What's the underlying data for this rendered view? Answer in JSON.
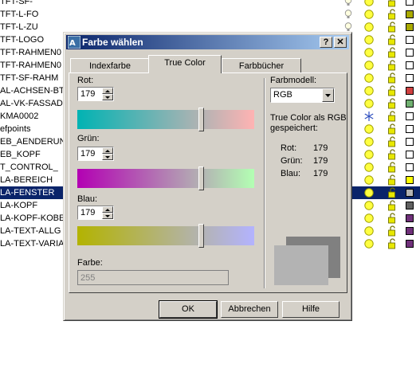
{
  "layers": [
    {
      "name": "TFT-SF-",
      "swatch": "#ffffff",
      "state": "off-sun"
    },
    {
      "name": "TFT-L-FO",
      "swatch": "#aaaa00",
      "state": "off"
    },
    {
      "name": "TFT-L-ZU",
      "swatch": "#aaaa00",
      "state": "off"
    },
    {
      "name": "TFT-LOGO",
      "swatch": "#ffffff",
      "state": "on"
    },
    {
      "name": "TFT-RAHMEN0",
      "swatch": "#ffffff",
      "state": "on"
    },
    {
      "name": "TFT-RAHMEN0",
      "swatch": "#ffffff",
      "state": "on"
    },
    {
      "name": "TFT-SF-RAHM",
      "swatch": "#ffffff",
      "state": "on"
    },
    {
      "name": "AL-ACHSEN-BT",
      "swatch": "#d04040",
      "state": "on"
    },
    {
      "name": "AL-VK-FASSAD",
      "swatch": "#70b070",
      "state": "on"
    },
    {
      "name": "KMA0002",
      "swatch": "#ffffff",
      "state": "frozen"
    },
    {
      "name": "efpoints",
      "swatch": "#ffffff",
      "state": "on"
    },
    {
      "name": "EB_AENDERUN",
      "swatch": "#ffffff",
      "state": "on"
    },
    {
      "name": "EB_KOPF",
      "swatch": "#ffffff",
      "state": "on"
    },
    {
      "name": "T_CONTROL_",
      "swatch": "#ffffff",
      "state": "on"
    },
    {
      "name": "LA-BEREICH",
      "swatch": "#ffff00",
      "state": "on"
    },
    {
      "name": "LA-FENSTER",
      "swatch": "#b3b3b3",
      "state": "selected"
    },
    {
      "name": "LA-KOPF",
      "swatch": "#606060",
      "state": "on"
    },
    {
      "name": "LA-KOPF-KOBE",
      "swatch": "#70307a",
      "state": "on"
    },
    {
      "name": "LA-TEXT-ALLG",
      "swatch": "#70307a",
      "state": "on"
    },
    {
      "name": "LA-TEXT-VARIA",
      "swatch": "#70307a",
      "state": "on"
    }
  ],
  "dialog": {
    "title": "Farbe wählen",
    "help_btn": "?",
    "close_btn": "✕",
    "tabs": [
      {
        "label": "Indexfarbe"
      },
      {
        "label": "True Color"
      },
      {
        "label": "Farbbücher"
      }
    ],
    "red_label": "Rot:",
    "red_value": "179",
    "green_label": "Grün:",
    "green_value": "179",
    "blue_label": "Blau:",
    "blue_value": "179",
    "color_label": "Farbe:",
    "color_value": "255",
    "model_label": "Farbmodell:",
    "model_value": "RGB",
    "info_text_1": "True Color als RGB",
    "info_text_2": "gespeichert:",
    "info_red_label": "Rot:",
    "info_red_value": "179",
    "info_green_label": "Grün:",
    "info_green_value": "179",
    "info_blue_label": "Blau:",
    "info_blue_value": "179",
    "slider_level": 0.7,
    "old_color": "#808080",
    "new_color": "#b3b3b3",
    "ok": "OK",
    "cancel": "Abbrechen",
    "help": "Hilfe"
  }
}
